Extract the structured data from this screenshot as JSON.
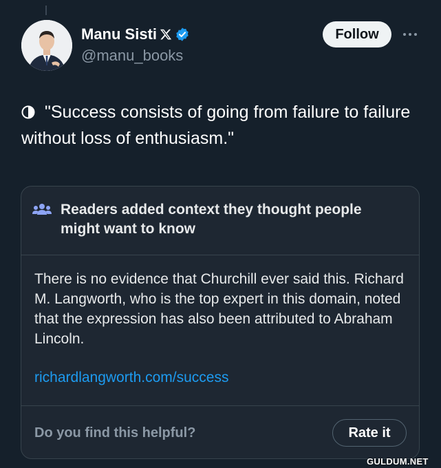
{
  "author": {
    "display_name": "Manu Sisti",
    "handle": "@manu_books"
  },
  "header": {
    "follow_label": "Follow"
  },
  "tweet": {
    "text": "\"Success consists of going from failure to failure without loss of enthusiasm.\""
  },
  "community_note": {
    "title": "Readers added context they thought people might want to know",
    "body": "There is no evidence that Churchill ever said this. Richard M. Langworth, who is the top expert in this domain, noted that the expression has also been attributed to Abraham Lincoln.",
    "link_text": "richardlangworth.com/success",
    "helpful_question": "Do you find this helpful?",
    "rate_label": "Rate it"
  },
  "watermark": "GULDUM.NET",
  "colors": {
    "background": "#15202b",
    "accent_link": "#1d9bf0",
    "verified": "#1d9bf0",
    "note_people_icon": "#8da4f5"
  },
  "icons": {
    "platform": "x-logo-icon",
    "verified": "verified-badge-icon",
    "more": "more-horizontal-icon",
    "tweet_prefix": "half-circle-icon",
    "note": "people-icon"
  }
}
